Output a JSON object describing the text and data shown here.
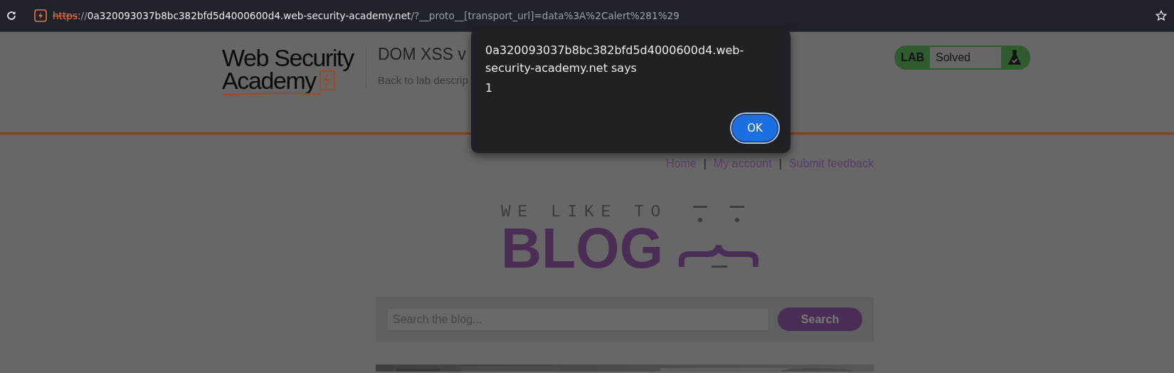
{
  "address_bar": {
    "scheme": "https",
    "separator": "://",
    "host": "0a320093037b8bc382bfd5d4000600d4.web-security-academy.net",
    "path": "/?__proto__[transport_url]=data%3A%2Calert%281%29",
    "not_secure": true
  },
  "header": {
    "logo": {
      "line_1": "Web Security",
      "line_2": "Academy"
    },
    "title": "DOM XSS v",
    "back_link": "Back to lab descrip",
    "lab_badge": {
      "label": "LAB",
      "status": "Solved",
      "solved": true
    }
  },
  "nav": {
    "links": [
      {
        "label": "Home"
      },
      {
        "label": "My account"
      },
      {
        "label": "Submit feedback"
      }
    ],
    "separators": [
      "|",
      "|"
    ]
  },
  "blog_logo": {
    "tagline": "WE LIKE TO",
    "word": "BLOG"
  },
  "search": {
    "placeholder": "Search the blog...",
    "button": "Search"
  },
  "dialog": {
    "message": "0a320093037b8bc382bfd5d4000600d4.web-security-academy.net says",
    "body": "1",
    "button": "OK"
  }
}
